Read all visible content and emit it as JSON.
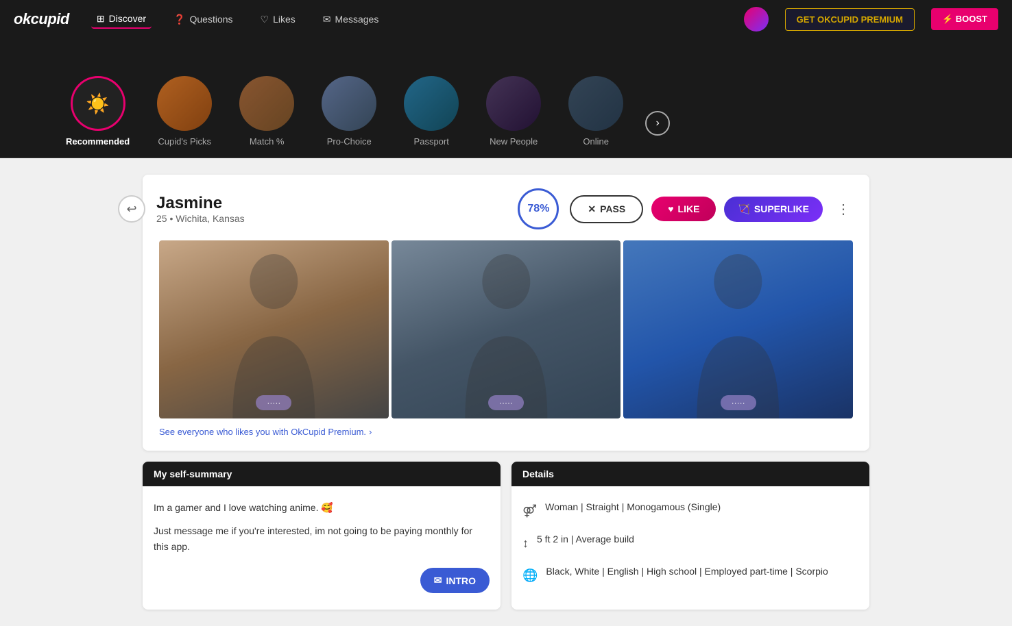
{
  "app": {
    "logo": "okcupid",
    "nav": [
      {
        "label": "Discover",
        "icon": "⊞",
        "active": true
      },
      {
        "label": "Questions",
        "icon": "?"
      },
      {
        "label": "Likes",
        "icon": "♡"
      },
      {
        "label": "Messages",
        "icon": "✉"
      }
    ],
    "btn_premium": "GET OKCUPID PREMIUM",
    "btn_boost": "⚡ BOOST"
  },
  "categories": [
    {
      "id": "recommended",
      "label": "Recommended",
      "active": true,
      "icon": "☀"
    },
    {
      "id": "cupids-picks",
      "label": "Cupid's Picks",
      "active": false
    },
    {
      "id": "match",
      "label": "Match %",
      "active": false
    },
    {
      "id": "pro-choice",
      "label": "Pro-Choice",
      "active": false
    },
    {
      "id": "passport",
      "label": "Passport",
      "active": false
    },
    {
      "id": "new-people",
      "label": "New People",
      "active": false
    },
    {
      "id": "online",
      "label": "Online",
      "active": false
    }
  ],
  "profile": {
    "name": "Jasmine",
    "age": "25",
    "location": "Wichita, Kansas",
    "match_pct": "78%",
    "btn_pass": "PASS",
    "btn_like": "LIKE",
    "btn_superlike": "SUPERLIKE",
    "premium_link": "See everyone who likes you with OkCupid Premium.",
    "photos": [
      {
        "label": "photo1"
      },
      {
        "label": "photo2"
      },
      {
        "label": "photo3"
      }
    ]
  },
  "self_summary": {
    "header": "My self-summary",
    "body1": "Im a gamer and I love watching anime. 🥰",
    "body2": "Just message me if you're interested, im not going to be paying monthly for this app.",
    "btn_intro": "INTRO"
  },
  "details": {
    "header": "Details",
    "items": [
      {
        "icon": "♀",
        "text": "Woman | Straight | Monogamous (Single)"
      },
      {
        "icon": "↕",
        "text": "5 ft 2 in | Average build"
      },
      {
        "icon": "🌐",
        "text": "Black, White | English | High school | Employed part-time | Scorpio"
      }
    ]
  }
}
